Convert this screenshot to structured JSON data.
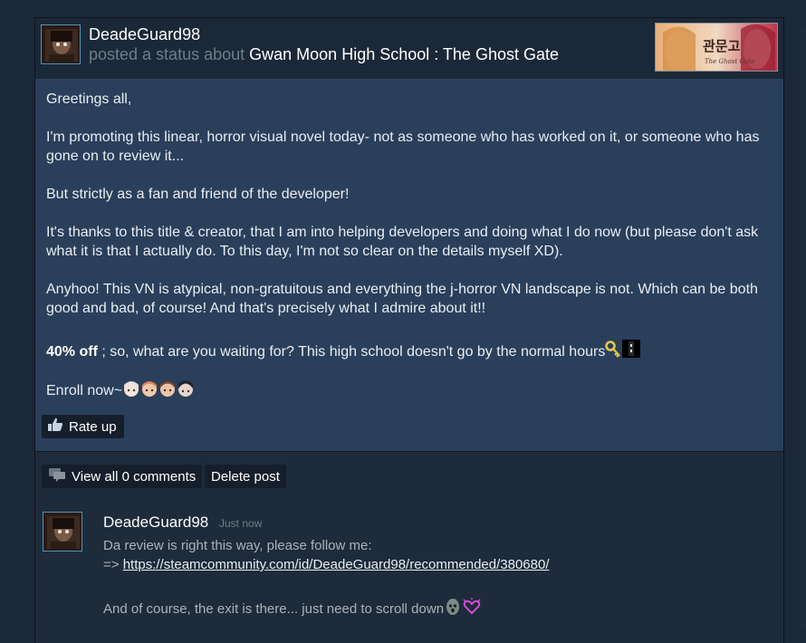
{
  "post": {
    "author": "DeadeGuard98",
    "status_prefix": "posted a status about",
    "game_title": "Gwan Moon High School : The Ghost Gate",
    "body": {
      "p1": "Greetings all,",
      "p2": "I'm promoting this linear, horror visual novel today- not as someone who has worked on it, or someone who has gone on to review it...",
      "p3": "But strictly as a fan and friend of the developer!",
      "p4": "It's thanks to this title & creator, that I am into helping developers and doing what I do now (but please don't ask what it is that I actually do. To this day, I'm not so clear on the details myself XD).",
      "p5": "Anyhoo! This VN is atypical, non-gratuitous and everything the j-horror VN landscape is not. Which can be both good and bad, of course! And that's precisely what I admire about it!!",
      "p6_bold": "40% off",
      "p6_rest": " ; so, what are you waiting for? This high school doesn't go by the normal hours",
      "p7": "Enroll now~"
    },
    "rate_label": "Rate up",
    "view_comments_label": "View all 0 comments",
    "delete_label": "Delete post"
  },
  "comment": {
    "author": "DeadeGuard98",
    "time": "Just now",
    "line1": "Da review is right this way, please follow me:",
    "arrow": "=> ",
    "link": "https://steamcommunity.com/id/DeadeGuard98/recommended/380680/",
    "line3": "And of course, the exit is there... just need to scroll down"
  },
  "colors": {
    "page_bg": "#1b2838",
    "body_bg": "#2a3f5a",
    "button_bg": "#151f2b",
    "muted_text": "#6f7d89",
    "avatar_border": "#4f93b5"
  },
  "icons": [
    "thumbs-up-icon",
    "speech-bubble-icon",
    "key-emoticon",
    "door-emoticon",
    "face-emoticon",
    "ghost-emoticon",
    "sparkle-heart-emoticon"
  ]
}
